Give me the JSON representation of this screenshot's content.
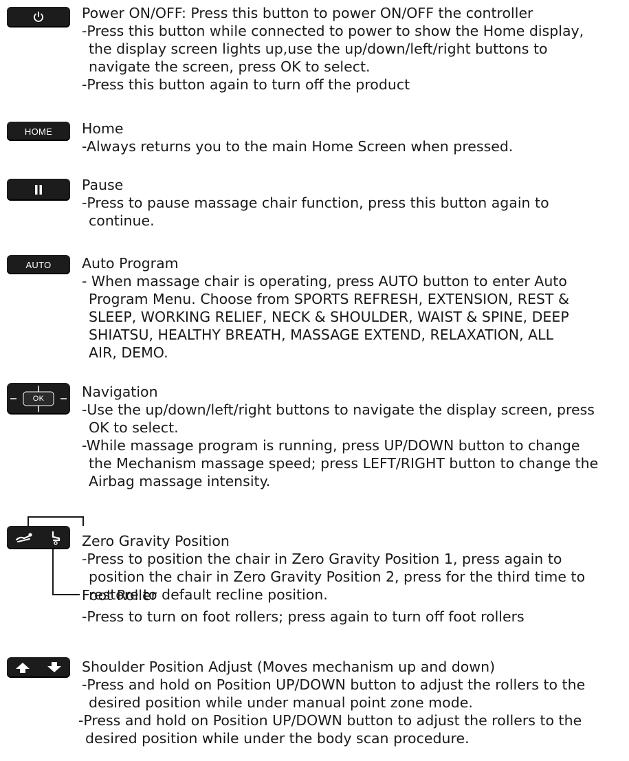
{
  "sections": {
    "power": {
      "title": "Power ON/OFF: Press this button to power ON/OFF the controller",
      "lines": [
        "-Press this button while connected to power to show the Home display,",
        "the display screen lights up,use the up/down/left/right buttons to",
        "navigate the screen, press OK to select.",
        "-Press this button again to turn off the product"
      ]
    },
    "home": {
      "button_label": "HOME",
      "title": "Home",
      "lines": [
        "-Always returns you to the main Home Screen when pressed."
      ]
    },
    "pause": {
      "title": "Pause",
      "lines": [
        "-Press to pause massage chair function, press this button again to",
        "continue."
      ]
    },
    "auto": {
      "button_label": "AUTO",
      "title": "Auto Program",
      "lines": [
        "- When massage chair is operating, press AUTO button to enter Auto",
        "Program Menu. Choose from SPORTS REFRESH, EXTENSION, REST &",
        "SLEEP, WORKING RELIEF, NECK & SHOULDER, WAIST & SPINE, DEEP",
        "SHIATSU, HEALTHY BREATH, MASSAGE EXTEND, RELAXATION, ALL",
        "AIR, DEMO."
      ]
    },
    "navigation": {
      "button_label": "OK",
      "title": "Navigation",
      "lines": [
        "-Use the up/down/left/right buttons to navigate the display screen, press",
        "OK to select.",
        "-While massage program is running, press UP/DOWN button to change",
        "the Mechanism massage speed; press LEFT/RIGHT button to change the",
        "Airbag massage intensity."
      ]
    },
    "zero_gravity": {
      "title": "Zero Gravity Position",
      "lines": [
        "-Press to position the chair in Zero Gravity Position 1, press again to",
        "position the chair in Zero Gravity Position 2, press for the third time to",
        "restore to default recline position."
      ]
    },
    "foot_roller": {
      "title": "Foot Roller",
      "lines": [
        "-Press to turn on foot rollers; press again to turn off foot rollers"
      ]
    },
    "shoulder": {
      "title": "Shoulder Position Adjust (Moves mechanism up and down)",
      "lines": [
        "-Press and hold on Position UP/DOWN button to adjust the rollers to the",
        "desired position while under manual point zone mode.",
        "-Press and hold on Position UP/DOWN button to adjust the rollers to the",
        "desired position while under the body scan procedure."
      ]
    }
  }
}
